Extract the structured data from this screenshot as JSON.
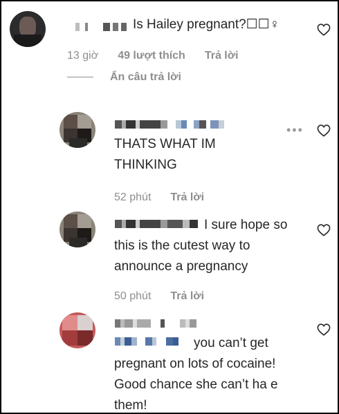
{
  "comments": [
    {
      "text": "Is Hailey pregnant?☐☐♀",
      "time": "13 giờ",
      "likes": "49 lượt thích",
      "reply": "Trả lời"
    },
    {
      "text": "THATS WHAT IM THINKING",
      "time": "52 phút",
      "reply": "Trả lời"
    },
    {
      "text": "I sure hope so this is the cutest way to announce a pregnancy",
      "time": "50 phút",
      "reply": "Trả lời"
    },
    {
      "text": "you can’t get pregnant on lots of cocaine! Good chance she can’t ha e them!"
    }
  ],
  "hide_replies": "Ẩn câu trả lời",
  "icons": {
    "like": "heart-outline-icon",
    "more": "more-options-icon"
  },
  "colors": {
    "text": "#262626",
    "meta": "#8e8e8e",
    "border": "#000000"
  }
}
